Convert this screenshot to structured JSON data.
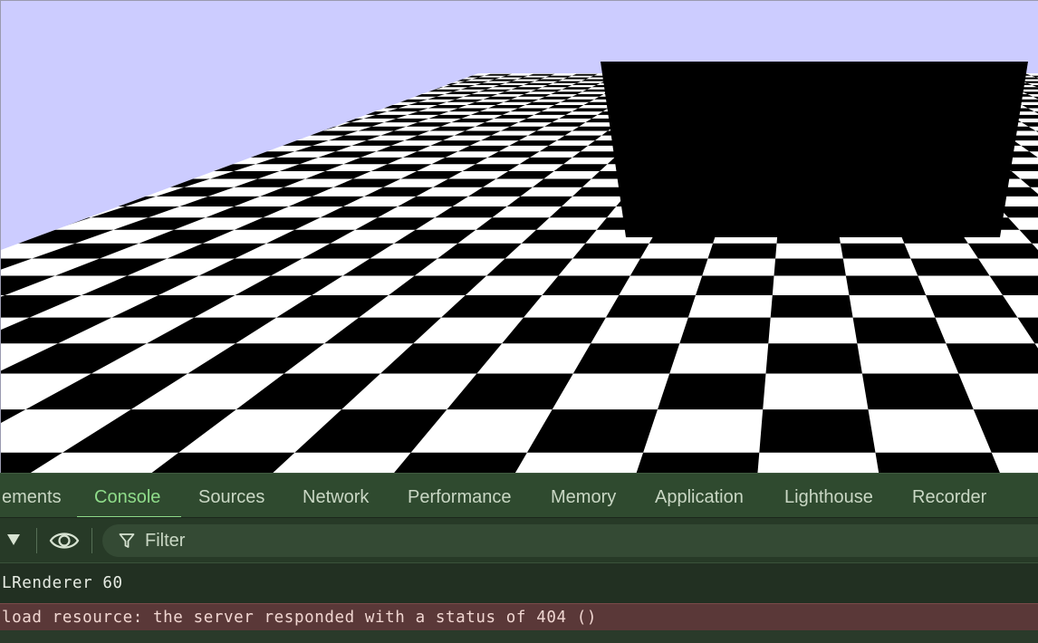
{
  "scene": {
    "sky_color": "#ccccff",
    "floor_dark": "#000000",
    "floor_light": "#ffffff",
    "wall_color": "#000000"
  },
  "devtools": {
    "tabs": [
      {
        "label": "ements"
      },
      {
        "label": "Console",
        "active": true
      },
      {
        "label": "Sources"
      },
      {
        "label": "Network"
      },
      {
        "label": "Performance"
      },
      {
        "label": "Memory"
      },
      {
        "label": "Application"
      },
      {
        "label": "Lighthouse"
      },
      {
        "label": "Recorder"
      }
    ],
    "accent_color": "#8fdc8a",
    "toolbar": {
      "filter_placeholder": "Filter",
      "icons": [
        "dropdown-arrow-icon",
        "eye-icon",
        "filter-icon"
      ]
    },
    "console": {
      "messages": [
        {
          "level": "info",
          "text": "LRenderer 60"
        },
        {
          "level": "error",
          "text": "load resource: the server responded with a status of 404 ()"
        }
      ]
    }
  }
}
